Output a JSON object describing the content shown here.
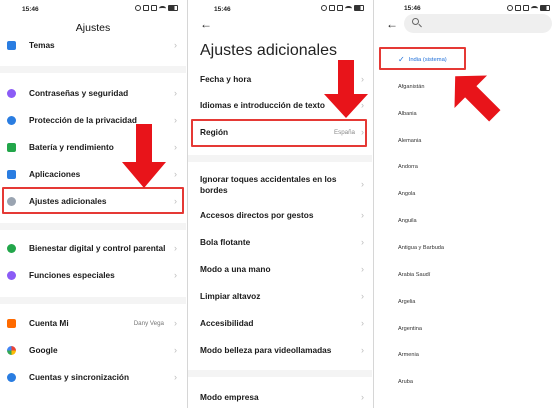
{
  "status": {
    "time": "15:46"
  },
  "panel1": {
    "title": "Ajustes",
    "items": [
      {
        "label": "Temas",
        "value": "",
        "color": "#2a7de1"
      },
      {
        "label": "Contraseñas y seguridad",
        "value": "",
        "color": "#8b5cf6"
      },
      {
        "label": "Protección de la privacidad",
        "value": "",
        "color": "#2a7de1"
      },
      {
        "label": "Batería y rendimiento",
        "value": "",
        "color": "#22a64a"
      },
      {
        "label": "Aplicaciones",
        "value": "",
        "color": "#2a7de1"
      },
      {
        "label": "Ajustes adicionales",
        "value": "",
        "color": "#9aa4b1"
      },
      {
        "label": "Bienestar digital y control parental",
        "value": "",
        "color": "#22a64a"
      },
      {
        "label": "Funciones especiales",
        "value": "",
        "color": "#8b5cf6"
      },
      {
        "label": "Cuenta Mi",
        "value": "Dany Vega",
        "color": "#ff6a00"
      },
      {
        "label": "Google",
        "value": "",
        "color": "#4285f4"
      },
      {
        "label": "Cuentas y sincronización",
        "value": "",
        "color": "#2a7de1"
      }
    ]
  },
  "panel2": {
    "back_icon": "←",
    "title": "Ajustes adicionales",
    "items": [
      {
        "label": "Fecha y hora",
        "value": ""
      },
      {
        "label": "Idiomas e introducción de texto",
        "value": ""
      },
      {
        "label": "Región",
        "value": "España"
      },
      {
        "label": "Ignorar toques accidentales en los bordes",
        "value": ""
      },
      {
        "label": "Accesos directos por gestos",
        "value": ""
      },
      {
        "label": "Bola flotante",
        "value": ""
      },
      {
        "label": "Modo a una mano",
        "value": ""
      },
      {
        "label": "Limpiar altavoz",
        "value": ""
      },
      {
        "label": "Accesibilidad",
        "value": ""
      },
      {
        "label": "Modo belleza para videollamadas",
        "value": ""
      },
      {
        "label": "Modo empresa",
        "value": ""
      }
    ]
  },
  "panel3": {
    "back_icon": "←",
    "search_placeholder": "",
    "selected": "India (sistema)",
    "countries": [
      "Afganistán",
      "Albania",
      "Alemania",
      "Andorra",
      "Angola",
      "Anguila",
      "Antigua y Barbuda",
      "Arabia Saudí",
      "Argelia",
      "Argentina",
      "Armenia",
      "Aruba"
    ]
  },
  "colors": {
    "highlight": "#e53935",
    "accent": "#1e6fd9"
  }
}
